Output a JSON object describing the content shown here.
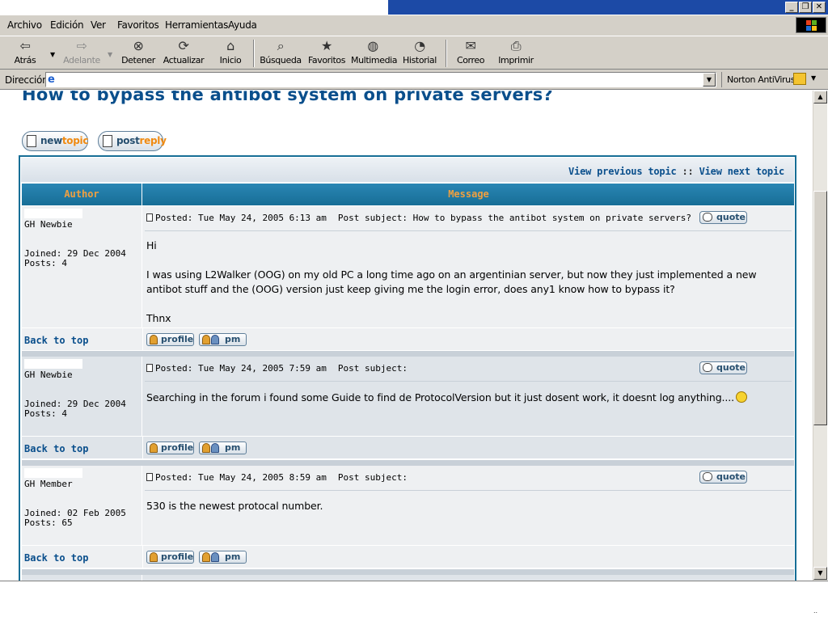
{
  "window": {
    "buttons": [
      "_",
      "❐",
      "✕"
    ]
  },
  "menu": {
    "items": [
      {
        "label": "Archivo"
      },
      {
        "label": "Edición"
      },
      {
        "label": "Ver"
      },
      {
        "label": "Favoritos"
      },
      {
        "label": "Herramientas"
      },
      {
        "label": "Ayuda"
      }
    ]
  },
  "toolbar": {
    "back": {
      "label": "Atrás",
      "icon": "back-arrow-icon"
    },
    "forward": {
      "label": "Adelante",
      "icon": "forward-arrow-icon"
    },
    "stop": {
      "label": "Detener",
      "icon": "stop-icon"
    },
    "refresh": {
      "label": "Actualizar",
      "icon": "refresh-icon"
    },
    "home": {
      "label": "Inicio",
      "icon": "home-icon"
    },
    "search": {
      "label": "Búsqueda",
      "icon": "search-icon"
    },
    "favorites": {
      "label": "Favoritos",
      "icon": "favorites-icon"
    },
    "media": {
      "label": "Multimedia",
      "icon": "media-icon"
    },
    "history": {
      "label": "Historial",
      "icon": "history-icon"
    },
    "mail": {
      "label": "Correo",
      "icon": "mail-icon"
    },
    "print": {
      "label": "Imprimir",
      "icon": "print-icon"
    }
  },
  "addressbar": {
    "label": "Dirección",
    "value": "",
    "norton": "Norton AntiVirus"
  },
  "page": {
    "title": "How to bypass the antibot system on private servers?",
    "new_topic": {
      "part1": "new",
      "part2": "topic"
    },
    "post_reply": {
      "part1": "post",
      "part2": "reply"
    },
    "nav": {
      "prev": "View previous topic",
      "sep": "::",
      "next": "View next topic"
    },
    "header": {
      "author": "Author",
      "message": "Message"
    },
    "quote_label": "quote",
    "profile_label": "profile",
    "pm_label": "pm",
    "back_to_top": "Back to top",
    "posts": [
      {
        "rank": "GH Newbie",
        "joined": "Joined: 29 Dec 2004",
        "posts": "Posts: 4",
        "posted": "Posted: Tue May 24, 2005 6:13 am",
        "subject": "Post subject: How to bypass the antibot system on private servers?",
        "body": [
          "Hi",
          "I was using L2Walker (OOG) on my old PC a long time ago on an argentinian server, but now they just implemented a new antibot stuff and the (OOG) version just keep giving me the login error, does any1 know how to bypass it?",
          "Thnx"
        ]
      },
      {
        "rank": "GH Newbie",
        "joined": "Joined: 29 Dec 2004",
        "posts": "Posts: 4",
        "posted": "Posted: Tue May 24, 2005 7:59 am",
        "subject": "Post subject:",
        "body": [
          "Searching in the forum i found some Guide to find de ProtocolVersion but it just dosent work, it doesnt log anything...."
        ]
      },
      {
        "rank": "GH Member",
        "joined": "Joined: 02 Feb 2005",
        "posts": "Posts: 65",
        "posted": "Posted: Tue May 24, 2005 8:59 am",
        "subject": "Post subject:",
        "body": [
          "530 is the newest protocal number."
        ]
      }
    ]
  },
  "colors": {
    "title": "#0a4f8c",
    "header_bg": "#176e96",
    "header_text": "#f0a040",
    "row_alt": "#dfe4e9",
    "row_light": "#eef0f2",
    "titlebar": "#1c4aa6"
  }
}
